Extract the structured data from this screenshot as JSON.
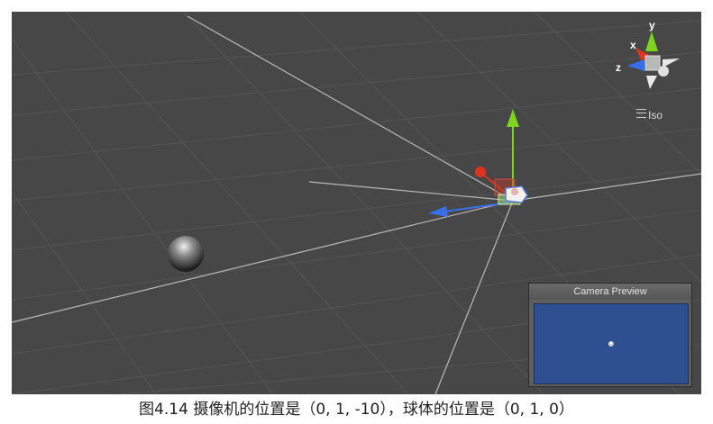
{
  "scene": {
    "gizmo_axes": {
      "y": "y",
      "x": "x",
      "z": "z"
    },
    "projection_label": "Iso",
    "colors": {
      "background": "#474747",
      "x_axis": "#e0331f",
      "y_axis": "#7ed321",
      "z_axis": "#3a6ee8"
    }
  },
  "camera_preview": {
    "title": "Camera Preview",
    "background": "#2f5090"
  },
  "caption": "图4.14 摄像机的位置是（0, 1, -10），球体的位置是（0, 1, 0）"
}
